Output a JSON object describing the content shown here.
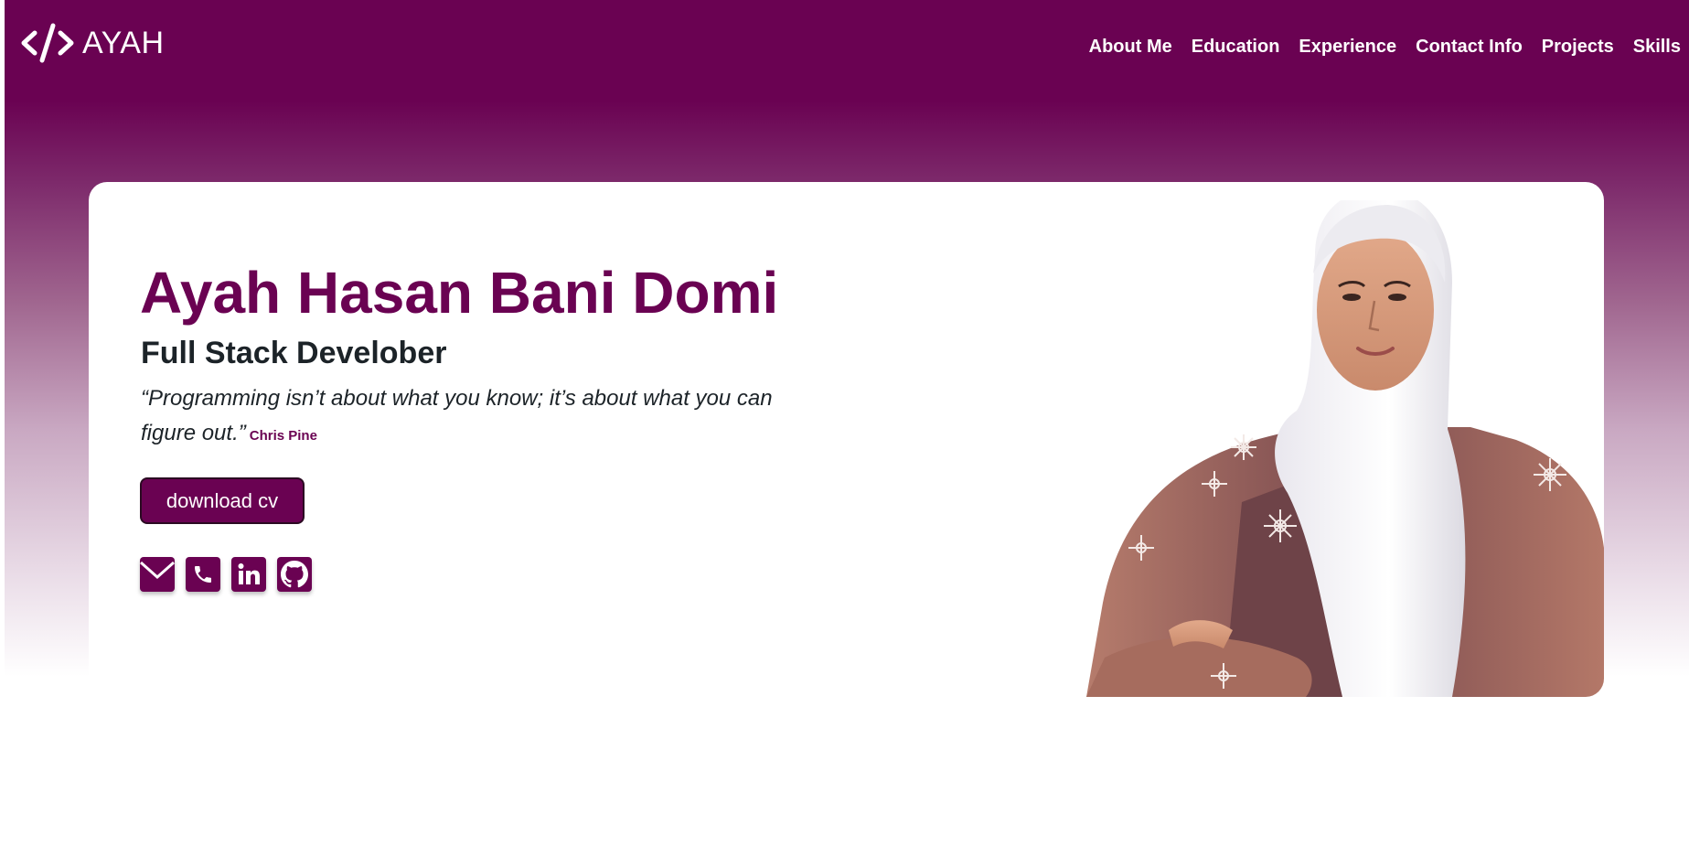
{
  "header": {
    "logo_text": "AYAH",
    "logo_icon": "code-icon",
    "nav": [
      {
        "label": "About Me"
      },
      {
        "label": "Education"
      },
      {
        "label": "Experience"
      },
      {
        "label": "Contact Info"
      },
      {
        "label": "Projects"
      },
      {
        "label": "Skills"
      }
    ]
  },
  "hero": {
    "name": "Ayah Hasan Bani Domi",
    "role": "Full Stack Develober",
    "quote": "“Programming isn’t about what you know; it’s about what you can figure out.”",
    "quote_author": "Chris Pine",
    "cv_button": "download cv",
    "socials": [
      {
        "icon": "mail-icon"
      },
      {
        "icon": "phone-icon"
      },
      {
        "icon": "linkedin-icon"
      },
      {
        "icon": "github-icon"
      }
    ]
  },
  "colors": {
    "primary": "#6a0252",
    "text_dark": "#1c2328",
    "white": "#ffffff"
  }
}
